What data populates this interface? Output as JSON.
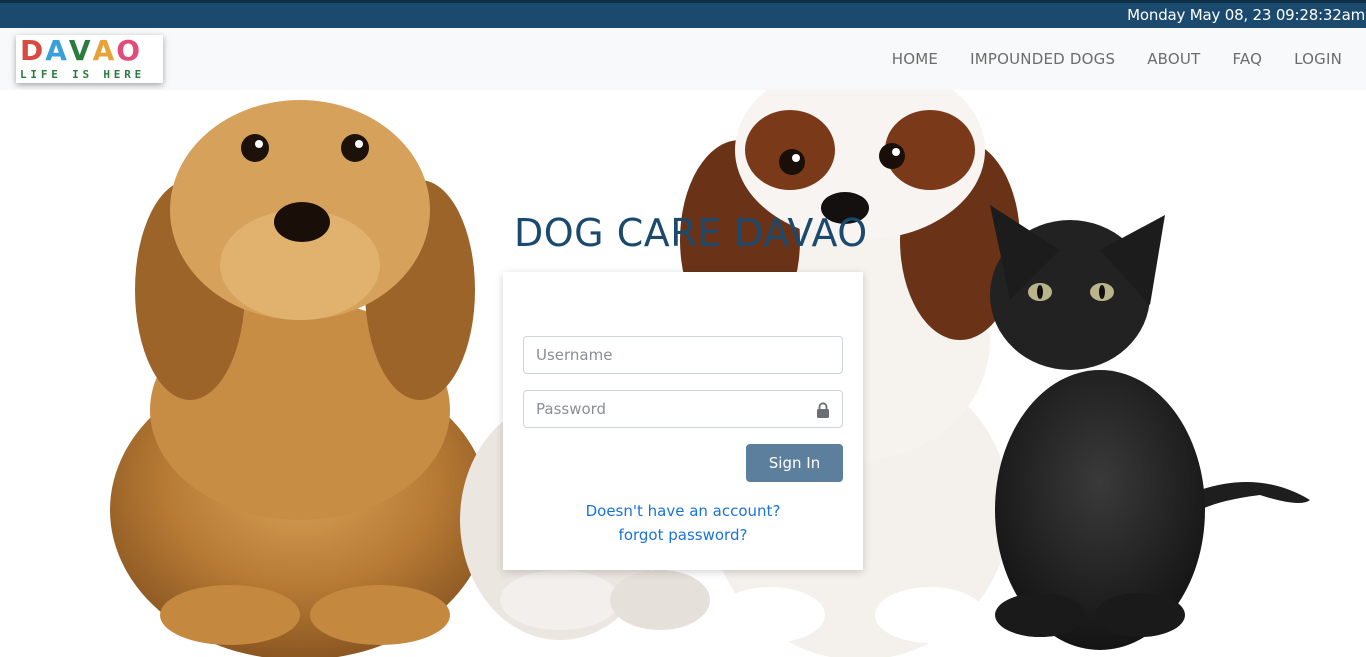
{
  "topbar": {
    "datetime": "Monday May 08, 23 09:28:32am"
  },
  "logo": {
    "letters": [
      "D",
      "A",
      "V",
      "A",
      "O"
    ],
    "letter_colors": [
      "#d94a3f",
      "#3aa0d9",
      "#2b7a3f",
      "#e8a23a",
      "#e04d7a"
    ],
    "tagline": "LIFE IS HERE"
  },
  "nav": {
    "items": [
      {
        "label": "HOME"
      },
      {
        "label": "IMPOUNDED DOGS"
      },
      {
        "label": "ABOUT"
      },
      {
        "label": "FAQ"
      },
      {
        "label": "LOGIN"
      }
    ]
  },
  "hero": {
    "title": "DOG CARE DAVAO"
  },
  "login": {
    "username_placeholder": "Username",
    "password_placeholder": "Password",
    "signin_label": "Sign In",
    "signup_link": "Doesn't have an account?",
    "forgot_link": "forgot password?"
  },
  "colors": {
    "topbar_bg": "#1b4a6e",
    "title_color": "#1b4a6e",
    "button_bg": "#5b7f9c",
    "link_color": "#1a73d9"
  }
}
